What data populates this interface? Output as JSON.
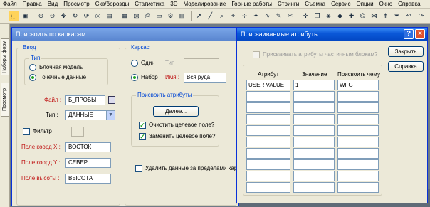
{
  "menu": [
    "Файл",
    "Правка",
    "Вид",
    "Просмотр",
    "Скв/борозды",
    "Статистика",
    "3D",
    "Моделирование",
    "Горные работы",
    "Стринги",
    "Съемка",
    "Сервис",
    "Опции",
    "Окно",
    "Справка"
  ],
  "sidebar": {
    "tab1": "Наборы форм",
    "tab2": "Просмотр"
  },
  "main_window": {
    "title": "Присвоить по каркасам",
    "input_group": "Ввод",
    "type_group": "Тип",
    "radio_block": "Блочная модель",
    "radio_points": "Точечные данные",
    "file_label": "Файл :",
    "file_value": "Б_ПРОБЫ",
    "type_label": "Тип :",
    "type_value": "ДАННЫЕ",
    "filter_label": "Фильтр",
    "x_label": "Поле коорд X :",
    "x_value": "ВОСТОК",
    "y_label": "Поле коорд Y :",
    "y_value": "СЕВЕР",
    "z_label": "Поле высоты :",
    "z_value": "ВЫСОТА",
    "wire_group": "Каркас",
    "radio_one": "Один",
    "type_short": "Тип :",
    "radio_set": "Набор",
    "name_label": "Имя :",
    "name_value": "Вся руда",
    "assign_group": "Присвоить атрибуты",
    "more_button": "Далее...",
    "clear_target": "Очистить целевое поле?",
    "replace_target": "Заменить целевое поле?",
    "delete_outside": "Удалить данные за пределами каркас"
  },
  "attr_window": {
    "title": "Присваиваемые атрибуты",
    "help_btn": "?",
    "close_x": "×",
    "partial_label": "Присваивать атрибуты частичным блокам?",
    "close_button": "Закрыть",
    "help_button": "Справка",
    "columns": [
      "Атрибут",
      "Значение",
      "Присвоить чему"
    ],
    "rows": [
      [
        "USER VALUE",
        "1",
        "WFG"
      ],
      [
        "",
        "",
        ""
      ],
      [
        "",
        "",
        ""
      ],
      [
        "",
        "",
        ""
      ],
      [
        "",
        "",
        ""
      ],
      [
        "",
        "",
        ""
      ],
      [
        "",
        "",
        ""
      ],
      [
        "",
        "",
        ""
      ],
      [
        "",
        "",
        ""
      ],
      [
        "",
        "",
        ""
      ]
    ]
  },
  "colors": {
    "title_active": "#0a58d8",
    "field_label": "#c01414",
    "group_title": "#0046d5"
  }
}
